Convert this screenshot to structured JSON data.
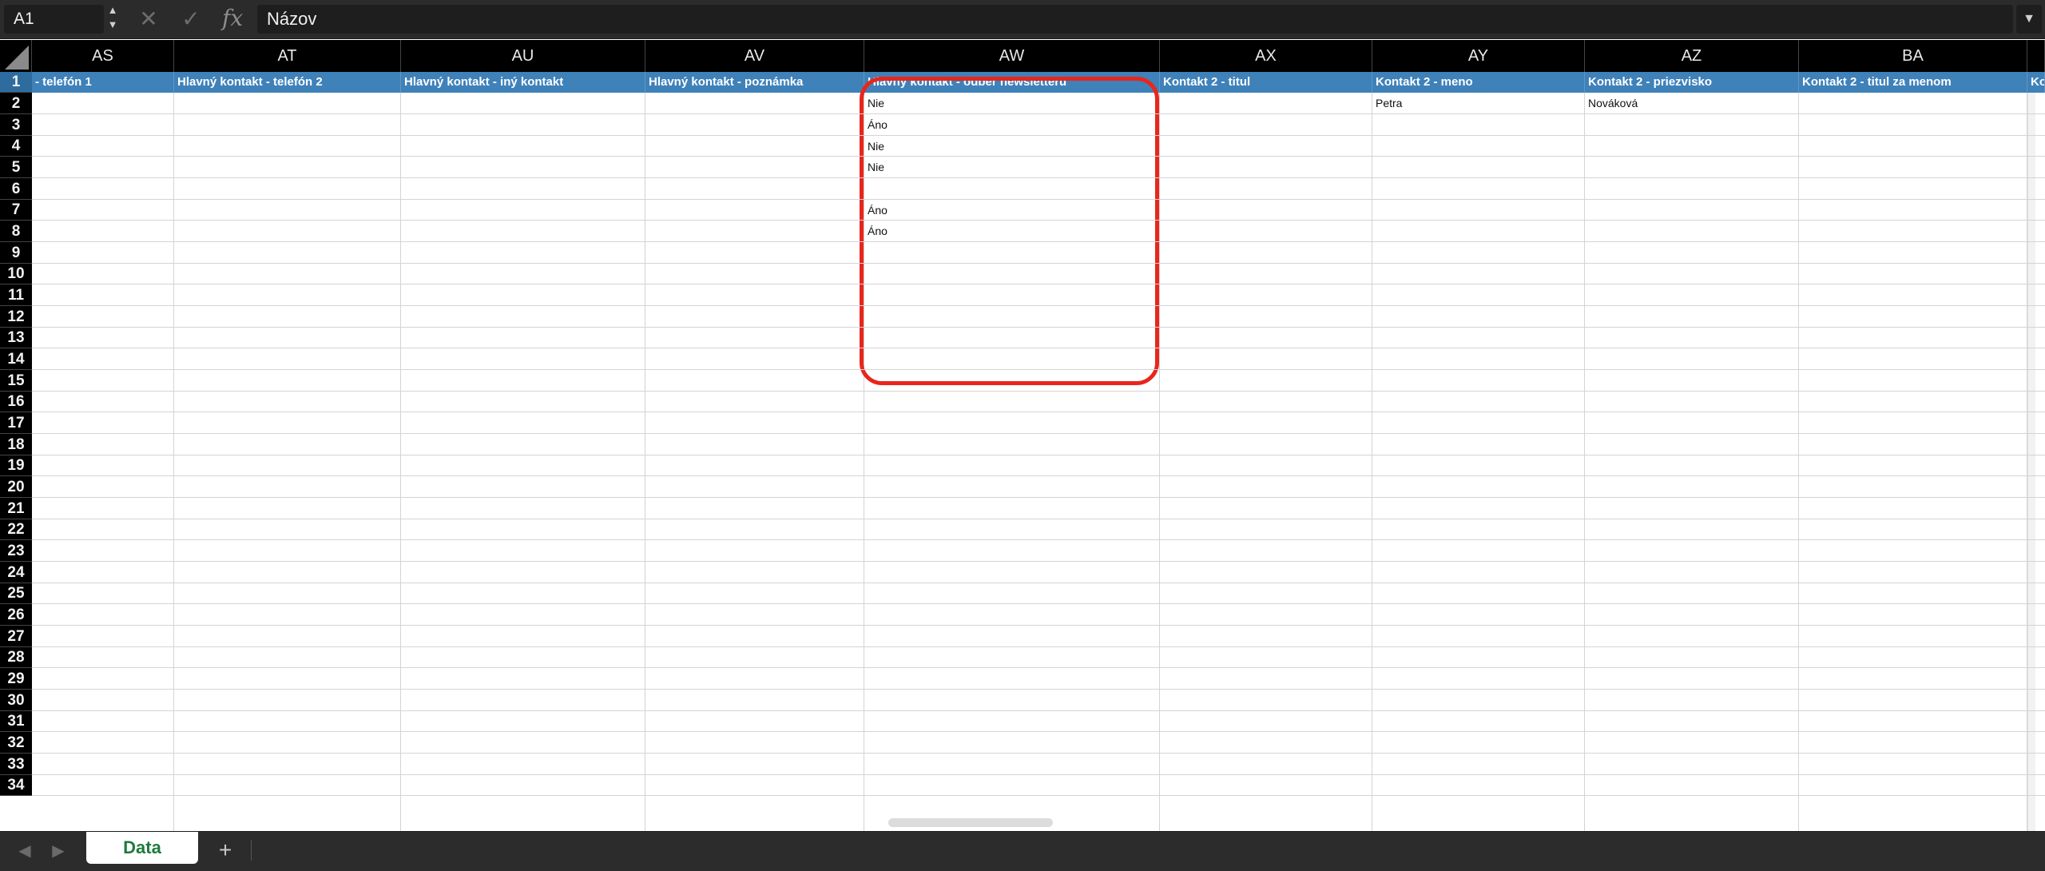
{
  "formula_bar": {
    "name_box": "A1",
    "stepper_glyph": "▲\n▼",
    "cancel_glyph": "✕",
    "confirm_glyph": "✓",
    "fx_label": "fx",
    "formula_value": "Názov",
    "dropdown_glyph": "▼"
  },
  "columns": [
    {
      "letter": "AS",
      "header": "- telefón 1"
    },
    {
      "letter": "AT",
      "header": "Hlavný kontakt - telefón 2"
    },
    {
      "letter": "AU",
      "header": "Hlavný kontakt - iný kontakt"
    },
    {
      "letter": "AV",
      "header": "Hlavný kontakt - poznámka"
    },
    {
      "letter": "AW",
      "header": "Hlavný kontakt - odber newsletteru"
    },
    {
      "letter": "AX",
      "header": "Kontakt 2 - titul"
    },
    {
      "letter": "AY",
      "header": "Kontakt 2 - meno"
    },
    {
      "letter": "AZ",
      "header": "Kontakt 2 - priezvisko"
    },
    {
      "letter": "BA",
      "header": "Kontakt 2 - titul za menom"
    },
    {
      "letter": "",
      "header": "Ko"
    }
  ],
  "row_numbers": [
    "1",
    "2",
    "3",
    "4",
    "5",
    "6",
    "7",
    "8",
    "9",
    "10",
    "11",
    "12",
    "13",
    "14",
    "15",
    "16",
    "17",
    "18",
    "19",
    "20",
    "21",
    "22",
    "23",
    "24",
    "25",
    "26",
    "27",
    "28",
    "29",
    "30",
    "31",
    "32",
    "33",
    "34"
  ],
  "cells": {
    "AW2": "Nie",
    "AW3": "Áno",
    "AW4": "Nie",
    "AW5": "Nie",
    "AW7": "Áno",
    "AW8": "Áno",
    "AY2": "Petra",
    "AZ2": "Nováková"
  },
  "tabs": {
    "prev_glyph": "◀",
    "next_glyph": "▶",
    "active_sheet": "Data",
    "add_glyph": "+"
  },
  "colors": {
    "header_row": "#3f81b9",
    "highlight": "#e8261b",
    "active_tab_text": "#1f7a3f"
  }
}
